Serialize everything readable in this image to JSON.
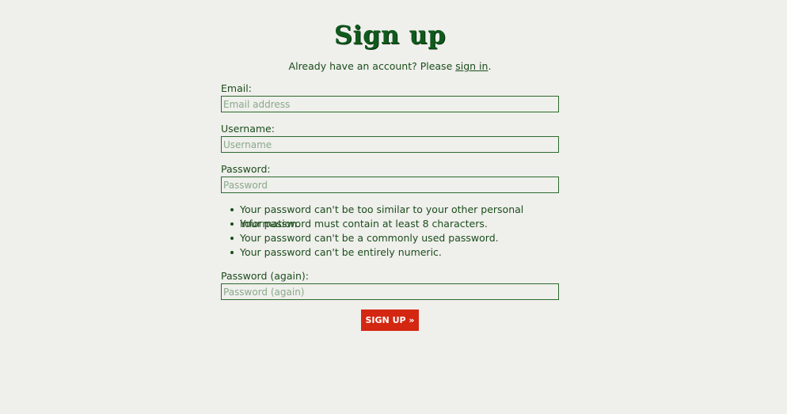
{
  "page": {
    "title": "Sign up",
    "already_text": "Already have an account? Please ",
    "signin_link": "sign in",
    "already_suffix": "."
  },
  "form": {
    "email": {
      "label": "Email:",
      "placeholder": "Email address",
      "value": ""
    },
    "username": {
      "label": "Username:",
      "placeholder": "Username",
      "value": ""
    },
    "password": {
      "label": "Password:",
      "placeholder": "Password",
      "value": ""
    },
    "password_help": [
      "Your password can't be too similar to your other personal information.",
      "Your password must contain at least 8 characters.",
      "Your password can't be a commonly used password.",
      "Your password can't be entirely numeric."
    ],
    "password2": {
      "label": "Password (again):",
      "placeholder": "Password (again)",
      "value": ""
    },
    "submit_label": "SIGN UP »"
  },
  "colors": {
    "background": "#efefec",
    "text": "#1b4d1b",
    "heading": "#0f5a1c",
    "button": "#d42712",
    "input_border": "#2d6a2d"
  }
}
